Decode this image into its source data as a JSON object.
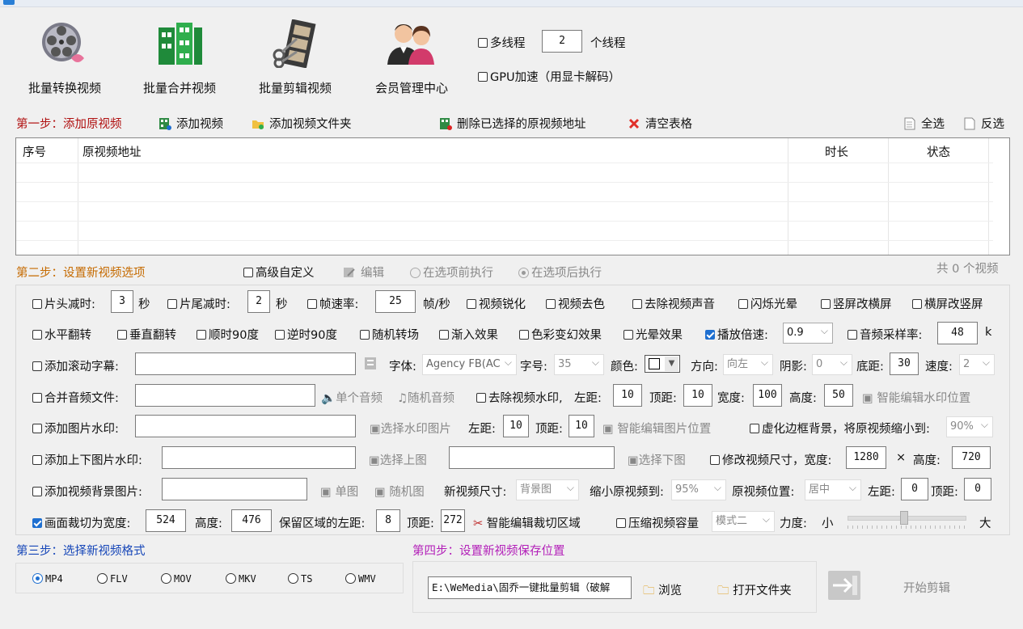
{
  "top": {
    "buttons": [
      {
        "label": "批量转换视频"
      },
      {
        "label": "批量合并视频"
      },
      {
        "label": "批量剪辑视频"
      },
      {
        "label": "会员管理中心"
      }
    ],
    "multithread_label": "多线程",
    "thread_count": "2",
    "thread_unit": "个线程",
    "gpu_label": "GPU加速（用显卡解码）"
  },
  "step1": {
    "title": "第一步：添加原视频",
    "add_video": "添加视频",
    "add_folder": "添加视频文件夹",
    "delete_selected": "删除已选择的原视频地址",
    "clear_table": "清空表格",
    "select_all": "全选",
    "invert": "反选",
    "columns": [
      "序号",
      "原视频地址",
      "时长",
      "状态"
    ]
  },
  "step2": {
    "title": "第二步：设置新视频选项",
    "advanced": "高级自定义",
    "edit": "编辑",
    "before": "在选项前执行",
    "after": "在选项后执行",
    "count_text": "共 0 个视频",
    "row1": {
      "head_cut": "片头减时:",
      "head_val": "3",
      "sec1": "秒",
      "tail_cut": "片尾减时:",
      "tail_val": "2",
      "sec2": "秒",
      "fps": "帧速率:",
      "fps_val": "25",
      "fps_unit": "帧/秒",
      "sharpen": "视频锐化",
      "decolor": "视频去色",
      "remove_audio": "去除视频声音",
      "flash": "闪烁光晕",
      "v2h": "竖屏改横屏",
      "h2v": "横屏改竖屏"
    },
    "row2": {
      "hflip": "水平翻转",
      "vflip": "垂直翻转",
      "cw90": "顺时90度",
      "ccw90": "逆时90度",
      "random_trans": "随机转场",
      "fade": "渐入效果",
      "color_magic": "色彩变幻效果",
      "glow": "光晕效果",
      "speed": "播放倍速:",
      "speed_val": "0.9",
      "sample_rate": "音频采样率:",
      "sample_val": "48",
      "sample_unit": "k"
    },
    "row3": {
      "subtitle": "添加滚动字幕:",
      "font": "字体:",
      "font_val": "Agency FB(AC",
      "size": "字号:",
      "size_val": "35",
      "color": "颜色:",
      "direction": "方向:",
      "direction_val": "向左",
      "shadow": "阴影:",
      "shadow_val": "0",
      "bottom": "底距:",
      "bottom_val": "30",
      "speed": "速度:",
      "speed_val": "2"
    },
    "row4": {
      "merge_audio": "合并音频文件:",
      "single_audio": "单个音频",
      "random_audio": "随机音频",
      "remove_wm": "去除视频水印,",
      "left": "左距:",
      "left_val": "10",
      "top": "顶距:",
      "top_val": "10",
      "width": "宽度:",
      "width_val": "100",
      "height": "高度:",
      "height_val": "50",
      "smart_wm": "智能编辑水印位置"
    },
    "row5": {
      "image_wm": "添加图片水印:",
      "choose_wm": "选择水印图片",
      "left": "左距:",
      "left_val": "10",
      "top": "顶距:",
      "top_val": "10",
      "smart_img": "智能编辑图片位置",
      "blur_border": "虚化边框背景，将原视频缩小到:",
      "blur_val": "90%"
    },
    "row6": {
      "tb_wm": "添加上下图片水印:",
      "choose_top": "选择上图",
      "choose_bottom": "选择下图",
      "resize": "修改视频尺寸，宽度:",
      "w_val": "1280",
      "times": "×",
      "h_label": "高度:",
      "h_val": "720"
    },
    "row7": {
      "bg_img": "添加视频背景图片:",
      "single_img": "单图",
      "random_img": "随机图",
      "new_size": "新视频尺寸:",
      "new_size_val": "背景图",
      "shrink": "缩小原视频到:",
      "shrink_val": "95%",
      "position": "原视频位置:",
      "position_val": "居中",
      "left": "左距:",
      "left_val": "0",
      "top": "顶距:",
      "top_val": "0"
    },
    "row8": {
      "crop": "画面裁切为宽度:",
      "crop_w": "524",
      "h_label": "高度:",
      "crop_h": "476",
      "keep_left": "保留区域的左距:",
      "keep_left_val": "8",
      "top": "顶距:",
      "top_val": "272",
      "smart_crop": "智能编辑裁切区域",
      "compress": "压缩视频容量",
      "mode_val": "模式二",
      "strength": "力度:",
      "small": "小",
      "large": "大"
    }
  },
  "step3": {
    "title": "第三步：选择新视频格式",
    "formats": [
      "MP4",
      "FLV",
      "MOV",
      "MKV",
      "TS",
      "WMV"
    ]
  },
  "step4": {
    "title": "第四步：设置新视频保存位置",
    "path": "E:\\WeMedia\\固乔一键批量剪辑（破解",
    "browse": "浏览",
    "open_folder": "打开文件夹",
    "start": "开始剪辑"
  }
}
